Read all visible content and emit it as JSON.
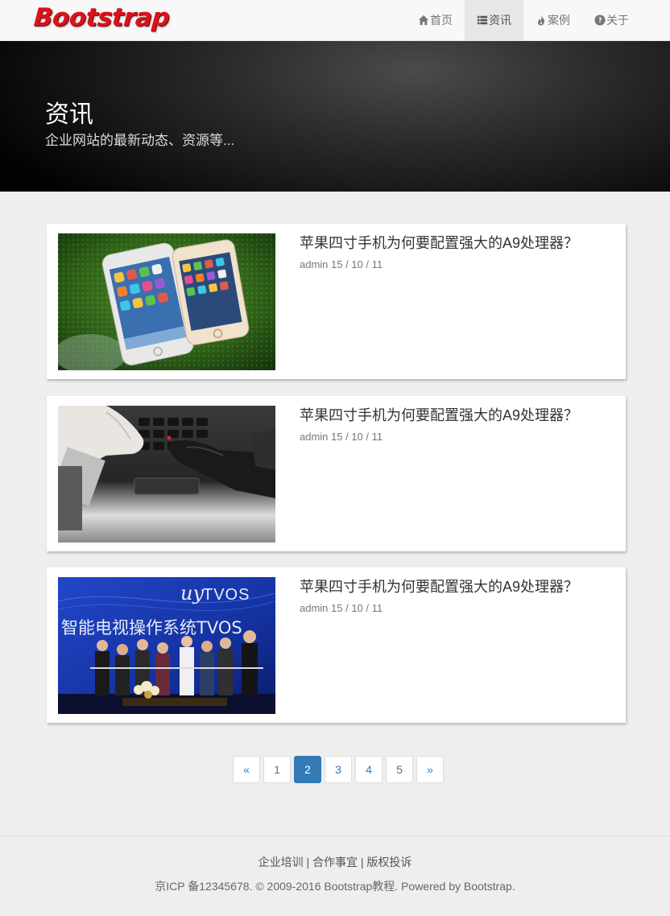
{
  "brand": "Bootstrap",
  "nav": {
    "items": [
      {
        "label": "首页",
        "icon": "home-icon"
      },
      {
        "label": "资讯",
        "icon": "list-icon",
        "active": true
      },
      {
        "label": "案例",
        "icon": "fire-icon"
      },
      {
        "label": "关于",
        "icon": "question-circle-icon"
      }
    ]
  },
  "hero": {
    "title": "资讯",
    "subtitle": "企业网站的最新动态、资源等..."
  },
  "articles": [
    {
      "title": "苹果四寸手机为何要配置强大的A9处理器？",
      "meta": "admin 15 / 10 / 11",
      "image": "iphones-on-grass"
    },
    {
      "title": "苹果四寸手机为何要配置强大的A9处理器？",
      "meta": "admin 15 / 10 / 11",
      "image": "hands-on-laptop"
    },
    {
      "title": "苹果四寸手机为何要配置强大的A9处理器？",
      "meta": "admin 15 / 10 / 11",
      "image": "tvos-launch-event"
    }
  ],
  "thumb_texts": {
    "tvos_logo": "TVOS",
    "tvos_banner": "智能电视操作系统TVOS"
  },
  "pagination": {
    "prev": "«",
    "pages": [
      "1",
      "2",
      "3",
      "4",
      "5"
    ],
    "current": "2",
    "next": "»"
  },
  "footer": {
    "links": [
      "企业培训",
      "合作事宜",
      "版权投诉"
    ],
    "separator": "|",
    "copyright": "京ICP 备12345678. © 2009-2016 Bootstrap教程. Powered by Bootstrap."
  },
  "colors": {
    "brand": "#d9131b",
    "link": "#337ab7",
    "page_bg": "#eeeeee"
  }
}
